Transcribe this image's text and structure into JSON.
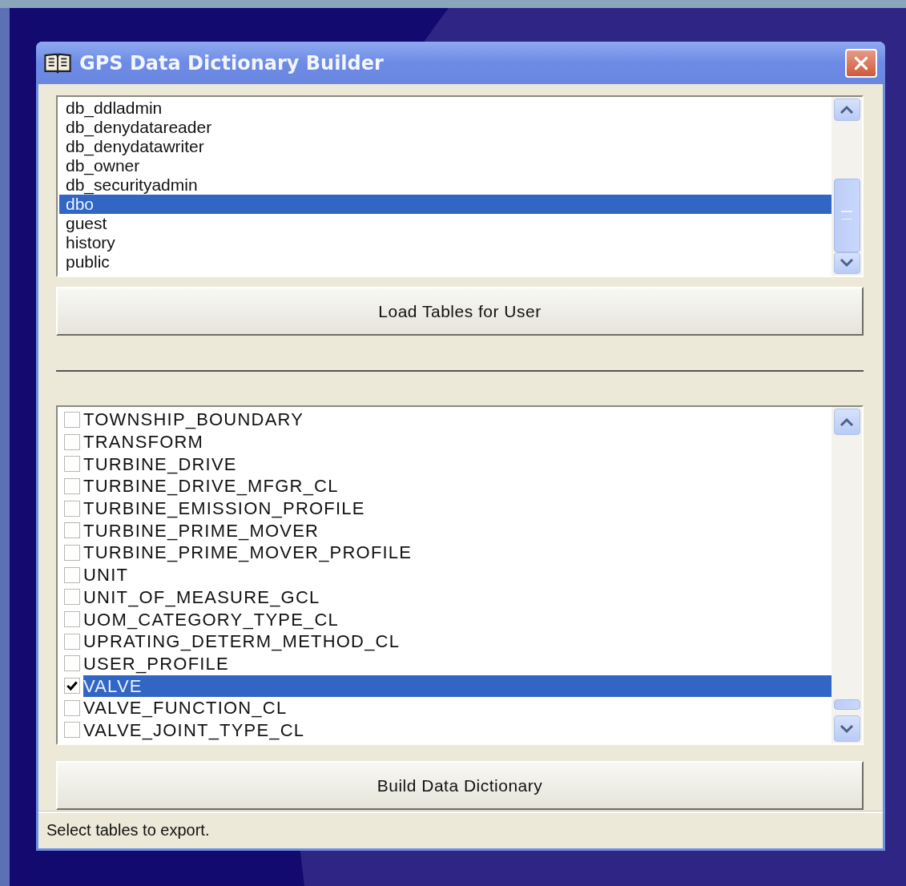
{
  "window": {
    "title": "GPS Data Dictionary Builder"
  },
  "users": [
    {
      "name": "db_ddladmin",
      "selected": false
    },
    {
      "name": "db_denydatareader",
      "selected": false
    },
    {
      "name": "db_denydatawriter",
      "selected": false
    },
    {
      "name": "db_owner",
      "selected": false
    },
    {
      "name": "db_securityadmin",
      "selected": false
    },
    {
      "name": "dbo",
      "selected": true
    },
    {
      "name": "guest",
      "selected": false
    },
    {
      "name": "history",
      "selected": false
    },
    {
      "name": "public",
      "selected": false
    }
  ],
  "load_button": "Load Tables for User",
  "tables": [
    {
      "name": "TOWNSHIP_BOUNDARY",
      "checked": false,
      "selected": false
    },
    {
      "name": "TRANSFORM",
      "checked": false,
      "selected": false
    },
    {
      "name": "TURBINE_DRIVE",
      "checked": false,
      "selected": false
    },
    {
      "name": "TURBINE_DRIVE_MFGR_CL",
      "checked": false,
      "selected": false
    },
    {
      "name": "TURBINE_EMISSION_PROFILE",
      "checked": false,
      "selected": false
    },
    {
      "name": "TURBINE_PRIME_MOVER",
      "checked": false,
      "selected": false
    },
    {
      "name": "TURBINE_PRIME_MOVER_PROFILE",
      "checked": false,
      "selected": false
    },
    {
      "name": "UNIT",
      "checked": false,
      "selected": false
    },
    {
      "name": "UNIT_OF_MEASURE_GCL",
      "checked": false,
      "selected": false
    },
    {
      "name": "UOM_CATEGORY_TYPE_CL",
      "checked": false,
      "selected": false
    },
    {
      "name": "UPRATING_DETERM_METHOD_CL",
      "checked": false,
      "selected": false
    },
    {
      "name": "USER_PROFILE",
      "checked": false,
      "selected": false
    },
    {
      "name": "VALVE",
      "checked": true,
      "selected": true
    },
    {
      "name": "VALVE_FUNCTION_CL",
      "checked": false,
      "selected": false
    },
    {
      "name": "VALVE_JOINT_TYPE_CL",
      "checked": false,
      "selected": false
    }
  ],
  "build_button": "Build Data Dictionary",
  "status_bar": "Select tables to export."
}
